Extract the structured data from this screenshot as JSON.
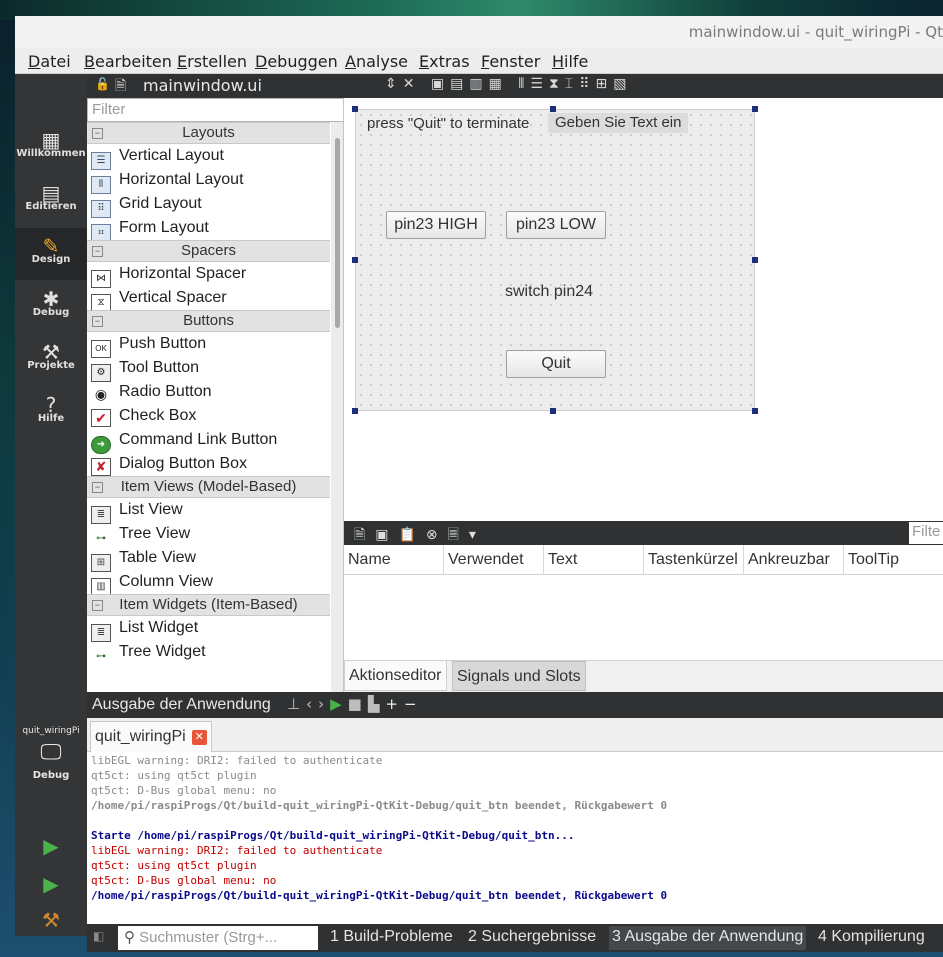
{
  "window": {
    "title": "mainwindow.ui - quit_wiringPi - Qt"
  },
  "menu": [
    "Datei",
    "Bearbeiten",
    "Erstellen",
    "Debuggen",
    "Analyse",
    "Extras",
    "Fenster",
    "Hilfe"
  ],
  "modes": [
    {
      "label": "Willkommen",
      "icon": "grid-icon"
    },
    {
      "label": "Editieren",
      "icon": "document-icon"
    },
    {
      "label": "Design",
      "icon": "pencil-icon"
    },
    {
      "label": "Debug",
      "icon": "bug-icon"
    },
    {
      "label": "Projekte",
      "icon": "wrench-icon"
    },
    {
      "label": "Hilfe",
      "icon": "help-icon"
    }
  ],
  "kit": {
    "name": "quit_wiringPi",
    "label": "Debug"
  },
  "editor": {
    "file": "mainwindow.ui"
  },
  "widgetbox": {
    "filter_placeholder": "Filter",
    "categories": {
      "layouts": "Layouts",
      "spacers": "Spacers",
      "buttons": "Buttons",
      "item_views": "Item Views (Model-Based)",
      "item_widgets": "Item Widgets (Item-Based)"
    },
    "items": {
      "vertical_layout": "Vertical Layout",
      "horizontal_layout": "Horizontal Layout",
      "grid_layout": "Grid Layout",
      "form_layout": "Form Layout",
      "horizontal_spacer": "Horizontal Spacer",
      "vertical_spacer": "Vertical Spacer",
      "push_button": "Push Button",
      "tool_button": "Tool Button",
      "radio_button": "Radio Button",
      "check_box": "Check Box",
      "command_link_button": "Command Link Button",
      "dialog_button_box": "Dialog Button Box",
      "list_view": "List View",
      "tree_view": "Tree View",
      "table_view": "Table View",
      "column_view": "Column View",
      "list_widget": "List Widget",
      "tree_widget": "Tree Widget"
    }
  },
  "form": {
    "label_quit": "press \"Quit\" to terminate",
    "line_edit": "Geben Sie Text ein",
    "btn_high": "pin23 HIGH",
    "btn_low": "pin23 LOW",
    "label_switch": "switch pin24",
    "btn_quit": "Quit"
  },
  "action_editor": {
    "filter_placeholder": "Filte",
    "columns": [
      "Name",
      "Verwendet",
      "Text",
      "Tastenkürzel",
      "Ankreuzbar",
      "ToolTip"
    ],
    "tabs": [
      "Aktionseditor",
      "Signals und Slots"
    ]
  },
  "output": {
    "title": "Ausgabe der Anwendung",
    "tab": "quit_wiringPi",
    "lines": [
      "libEGL warning: DRI2: failed to authenticate",
      "qt5ct: using qt5ct plugin",
      "qt5ct: D-Bus global menu: no",
      "/home/pi/raspiProgs/Qt/build-quit_wiringPi-QtKit-Debug/quit_btn beendet, Rückgabewert 0",
      "",
      "Starte /home/pi/raspiProgs/Qt/build-quit_wiringPi-QtKit-Debug/quit_btn...",
      "libEGL warning: DRI2: failed to authenticate",
      "qt5ct: using qt5ct plugin",
      "qt5ct: D-Bus global menu: no",
      "/home/pi/raspiProgs/Qt/build-quit_wiringPi-QtKit-Debug/quit_btn beendet, Rückgabewert 0"
    ]
  },
  "statusbar": {
    "search_placeholder": "Suchmuster (Strg+...",
    "panes": [
      "1 Build-Probleme",
      "2 Suchergebnisse",
      "3 Ausgabe der Anwendung",
      "4 Kompilierung"
    ]
  }
}
